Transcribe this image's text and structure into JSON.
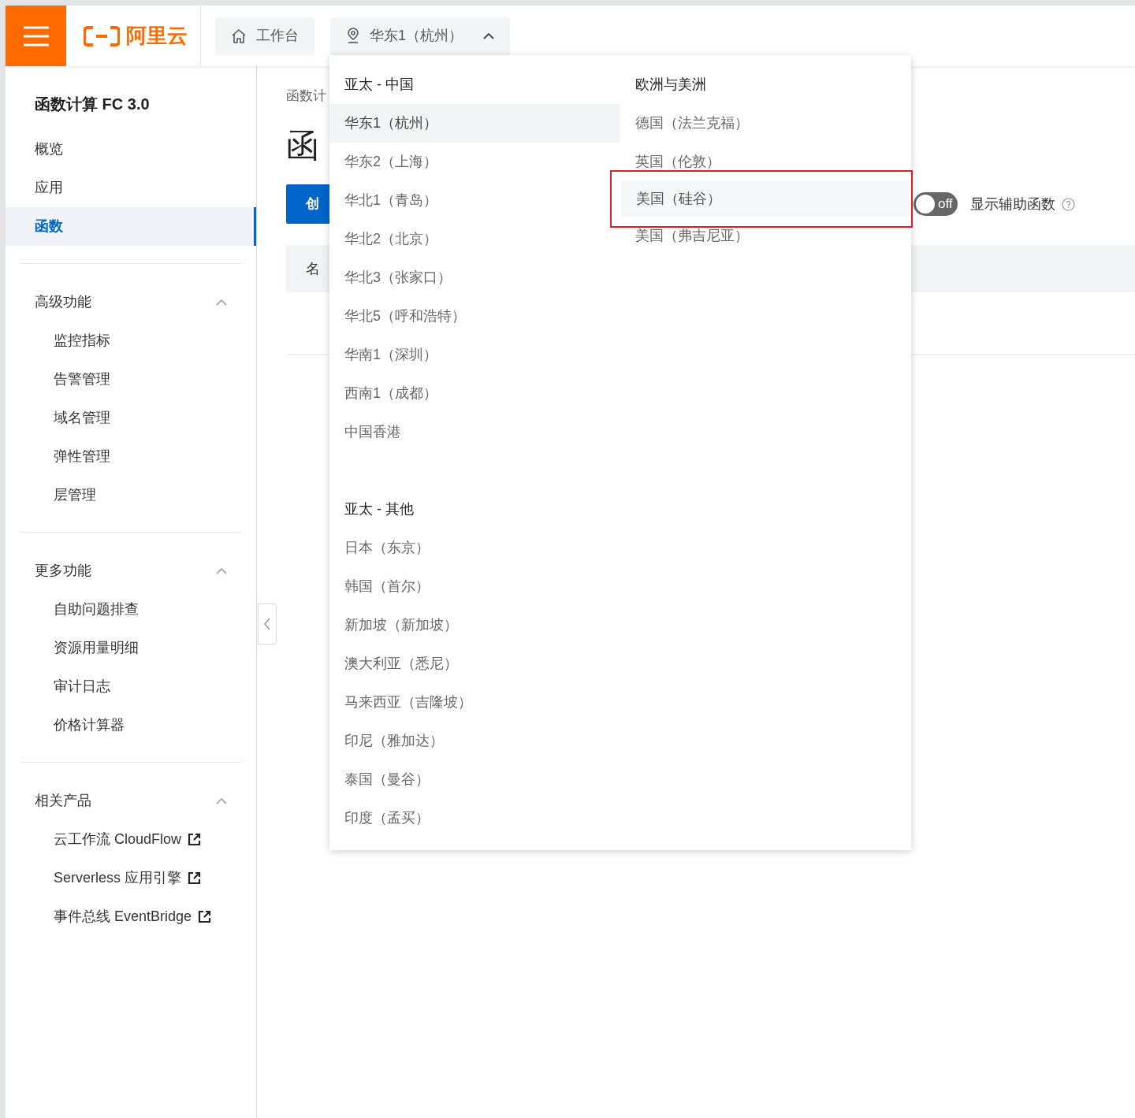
{
  "header": {
    "logo_text": "阿里云",
    "nav": [
      {
        "label": "工作台"
      },
      {
        "label": "华东1（杭州）",
        "expanded": true
      }
    ]
  },
  "sidebar": {
    "title": "函数计算 FC 3.0",
    "items": [
      {
        "label": "概览",
        "selected": false
      },
      {
        "label": "应用",
        "selected": false
      },
      {
        "label": "函数",
        "selected": true
      }
    ],
    "groups": [
      {
        "label": "高级功能",
        "expanded": true,
        "kind": "pages",
        "items": [
          "监控指标",
          "告警管理",
          "域名管理",
          "弹性管理",
          "层管理"
        ]
      },
      {
        "label": "更多功能",
        "expanded": true,
        "kind": "pages",
        "items": [
          "自助问题排查",
          "资源用量明细",
          "审计日志",
          "价格计算器"
        ]
      },
      {
        "label": "相关产品",
        "expanded": true,
        "kind": "links",
        "items": [
          "云工作流 CloudFlow",
          "Serverless 应用引擎",
          "事件总线 EventBridge"
        ]
      }
    ]
  },
  "main": {
    "breadcrumb": "函数计",
    "heading": "函",
    "create_button": "创",
    "toggle": {
      "label": "off",
      "on": false
    },
    "helper_label": "显示辅助函数",
    "table": {
      "column_1": "名"
    }
  },
  "region_menu": {
    "columns": [
      {
        "groups": [
          {
            "label": "亚太 - 中国",
            "items": [
              {
                "label": "华东1（杭州）",
                "selected": true,
                "highlighted": false
              },
              {
                "label": "华东2（上海）",
                "selected": false,
                "highlighted": false
              },
              {
                "label": "华北1（青岛）",
                "selected": false,
                "highlighted": false
              },
              {
                "label": "华北2（北京）",
                "selected": false,
                "highlighted": false
              },
              {
                "label": "华北3（张家口）",
                "selected": false,
                "highlighted": false
              },
              {
                "label": "华北5（呼和浩特）",
                "selected": false,
                "highlighted": false
              },
              {
                "label": "华南1（深圳）",
                "selected": false,
                "highlighted": false
              },
              {
                "label": "西南1（成都）",
                "selected": false,
                "highlighted": false
              },
              {
                "label": "中国香港",
                "selected": false,
                "highlighted": false
              }
            ]
          },
          {
            "label": "亚太 - 其他",
            "items": [
              {
                "label": "日本（东京）",
                "selected": false,
                "highlighted": false
              },
              {
                "label": "韩国（首尔）",
                "selected": false,
                "highlighted": false
              },
              {
                "label": "新加坡（新加坡）",
                "selected": false,
                "highlighted": false
              },
              {
                "label": "澳大利亚（悉尼）",
                "selected": false,
                "highlighted": false
              },
              {
                "label": "马来西亚（吉隆坡）",
                "selected": false,
                "highlighted": false
              },
              {
                "label": "印尼（雅加达）",
                "selected": false,
                "highlighted": false
              },
              {
                "label": "泰国（曼谷）",
                "selected": false,
                "highlighted": false
              },
              {
                "label": "印度（孟买）",
                "selected": false,
                "highlighted": false
              }
            ]
          }
        ]
      },
      {
        "groups": [
          {
            "label": "欧洲与美洲",
            "items": [
              {
                "label": "德国（法兰克福）",
                "selected": false,
                "highlighted": false
              },
              {
                "label": "英国（伦敦）",
                "selected": false,
                "highlighted": false
              },
              {
                "label": "美国（硅谷）",
                "selected": false,
                "highlighted": true
              },
              {
                "label": "美国（弗吉尼亚）",
                "selected": false,
                "highlighted": false
              }
            ]
          }
        ]
      }
    ]
  }
}
